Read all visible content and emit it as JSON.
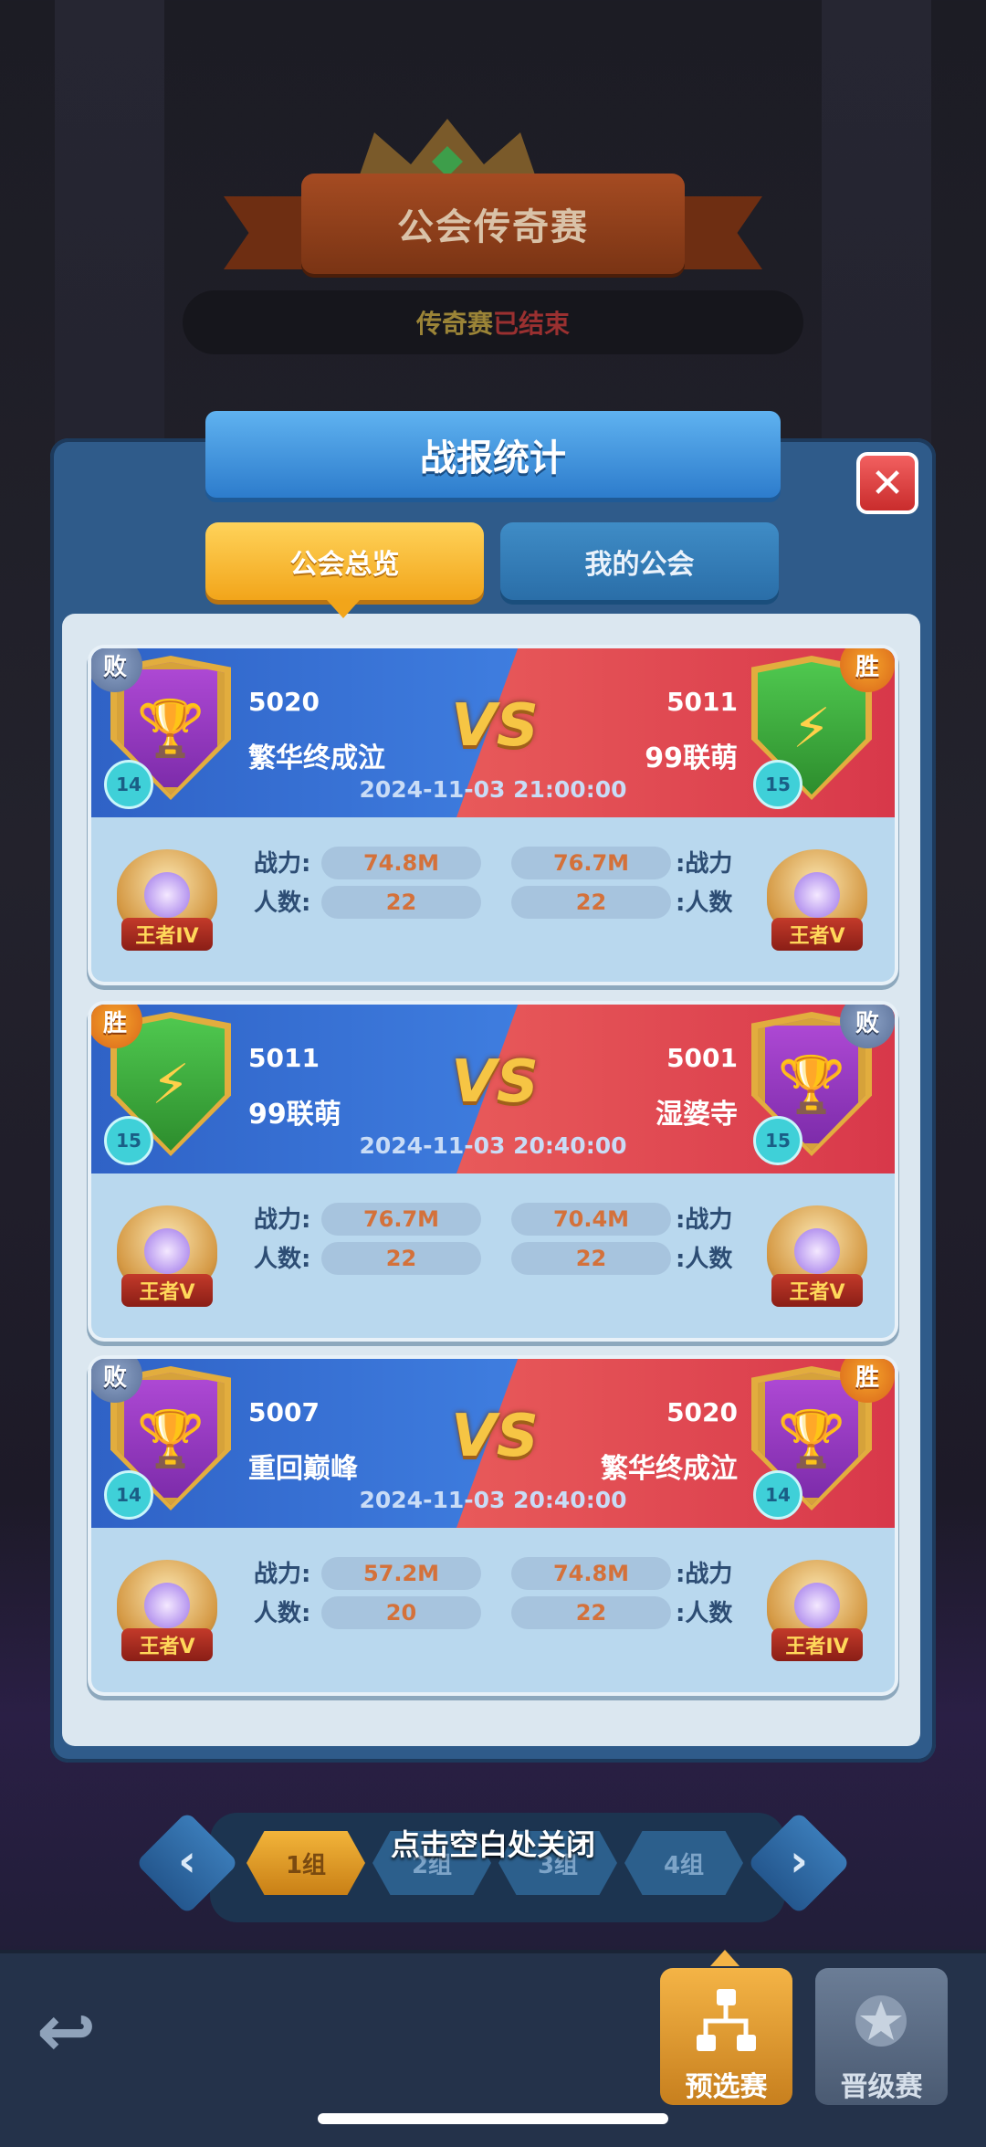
{
  "header": {
    "title": "公会传奇赛",
    "status_prefix": "传奇赛",
    "status_suffix": "已结束"
  },
  "dialog": {
    "title": "战报统计",
    "close_glyph": "✕",
    "tabs": [
      {
        "label": "公会总览",
        "active": true
      },
      {
        "label": "我的公会",
        "active": false
      }
    ]
  },
  "labels": {
    "power_left": "战力:",
    "members_left": "人数:",
    "power_right": ":战力",
    "members_right": ":人数",
    "vs": "VS"
  },
  "matches": [
    {
      "datetime": "2024-11-03 21:00:00",
      "left": {
        "id": "5020",
        "name": "繁华终成泣",
        "level": "14",
        "result": "败",
        "emblem": "trophy-icon",
        "rank": "王者IV",
        "power": "74.8M",
        "members": "22"
      },
      "right": {
        "id": "5011",
        "name": "99联萌",
        "level": "15",
        "result": "胜",
        "emblem": "lightning-icon",
        "rank": "王者V",
        "power": "76.7M",
        "members": "22"
      }
    },
    {
      "datetime": "2024-11-03 20:40:00",
      "left": {
        "id": "5011",
        "name": "99联萌",
        "level": "15",
        "result": "胜",
        "emblem": "lightning-icon",
        "rank": "王者V",
        "power": "76.7M",
        "members": "22"
      },
      "right": {
        "id": "5001",
        "name": "湿婆寺",
        "level": "15",
        "result": "败",
        "emblem": "trophy-icon",
        "rank": "王者V",
        "power": "70.4M",
        "members": "22"
      }
    },
    {
      "datetime": "2024-11-03 20:40:00",
      "left": {
        "id": "5007",
        "name": "重回巅峰",
        "level": "14",
        "result": "败",
        "emblem": "trophy-icon",
        "rank": "王者V",
        "power": "57.2M",
        "members": "20"
      },
      "right": {
        "id": "5020",
        "name": "繁华终成泣",
        "level": "14",
        "result": "胜",
        "emblem": "trophy-icon",
        "rank": "王者IV",
        "power": "74.8M",
        "members": "22"
      }
    }
  ],
  "groups": {
    "items": [
      "1组",
      "2组",
      "3组",
      "4组"
    ],
    "active_index": 0,
    "prev_glyph": "‹",
    "next_glyph": "›"
  },
  "close_hint": "点击空白处关闭",
  "bottom_nav": {
    "back_glyph": "↩",
    "prelim_label": "预选赛",
    "promo_label": "晋级赛"
  },
  "colors": {
    "blue_side": "#3f7ee0",
    "red_side": "#d8384a",
    "accent_gold": "#f2a51a"
  }
}
